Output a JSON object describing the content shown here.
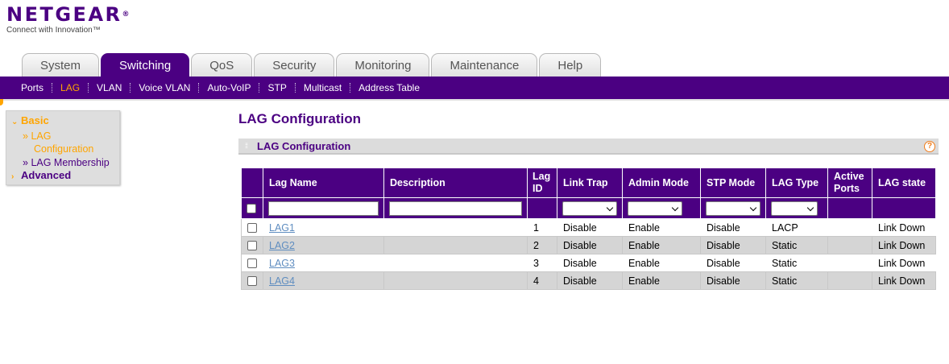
{
  "brand": {
    "logo_text": "NETGEAR",
    "logo_mark": "®",
    "tagline": "Connect with Innovation™"
  },
  "tabs": [
    {
      "label": "System",
      "active": false
    },
    {
      "label": "Switching",
      "active": true
    },
    {
      "label": "QoS",
      "active": false
    },
    {
      "label": "Security",
      "active": false
    },
    {
      "label": "Monitoring",
      "active": false
    },
    {
      "label": "Maintenance",
      "active": false
    },
    {
      "label": "Help",
      "active": false
    }
  ],
  "subnav": [
    {
      "label": "Ports",
      "active": false
    },
    {
      "label": "LAG",
      "active": true
    },
    {
      "label": "VLAN",
      "active": false
    },
    {
      "label": "Voice VLAN",
      "active": false
    },
    {
      "label": "Auto-VoIP",
      "active": false
    },
    {
      "label": "STP",
      "active": false
    },
    {
      "label": "Multicast",
      "active": false
    },
    {
      "label": "Address Table",
      "active": false
    }
  ],
  "sidebar": {
    "basic_label": "Basic",
    "items": [
      {
        "label_line1": "LAG",
        "label_line2": "Configuration",
        "active": true
      },
      {
        "label_line1": "LAG Membership",
        "label_line2": "",
        "active": false
      }
    ],
    "advanced_label": "Advanced"
  },
  "page": {
    "title": "LAG Configuration",
    "section_title": "LAG Configuration",
    "help_glyph": "?"
  },
  "table": {
    "headers": {
      "lag_name": "Lag Name",
      "description": "Description",
      "lag_id_line1": "Lag",
      "lag_id_line2": "ID",
      "link_trap": "Link Trap",
      "admin_mode": "Admin Mode",
      "stp_mode": "STP Mode",
      "lag_type": "LAG Type",
      "active_ports_line1": "Active",
      "active_ports_line2": "Ports",
      "lag_state": "LAG state"
    },
    "rows": [
      {
        "name": "LAG1",
        "description": "",
        "id": "1",
        "link_trap": "Disable",
        "admin_mode": "Enable",
        "stp_mode": "Disable",
        "lag_type": "LACP",
        "active_ports": "",
        "state": "Link Down"
      },
      {
        "name": "LAG2",
        "description": "",
        "id": "2",
        "link_trap": "Disable",
        "admin_mode": "Enable",
        "stp_mode": "Disable",
        "lag_type": "Static",
        "active_ports": "",
        "state": "Link Down"
      },
      {
        "name": "LAG3",
        "description": "",
        "id": "3",
        "link_trap": "Disable",
        "admin_mode": "Enable",
        "stp_mode": "Disable",
        "lag_type": "Static",
        "active_ports": "",
        "state": "Link Down"
      },
      {
        "name": "LAG4",
        "description": "",
        "id": "4",
        "link_trap": "Disable",
        "admin_mode": "Enable",
        "stp_mode": "Disable",
        "lag_type": "Static",
        "active_ports": "",
        "state": "Link Down"
      }
    ]
  },
  "colors": {
    "brand_purple": "#4b0082",
    "accent_orange": "#ffa500",
    "link_blue": "#5f8dc0",
    "row_alt": "#d5d5d5"
  }
}
